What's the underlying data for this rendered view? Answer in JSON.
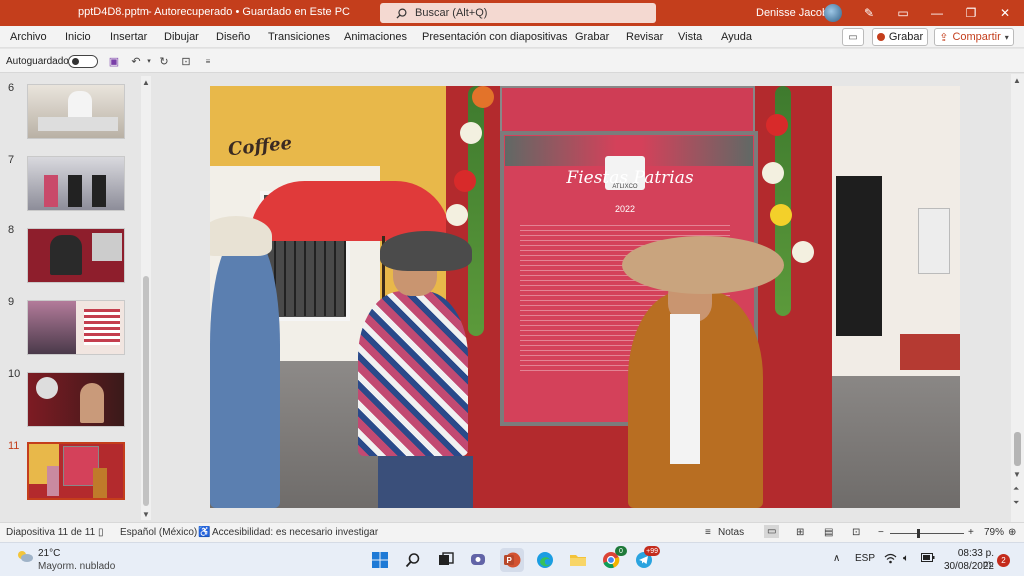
{
  "titlebar": {
    "doc_name": "pptD4D8.pptm",
    "status": "-  Autorecuperado • Guardado en Este PC",
    "search_placeholder": "Buscar (Alt+Q)",
    "user_name": "Denisse Jacobo"
  },
  "menu": [
    "Archivo",
    "Inicio",
    "Insertar",
    "Dibujar",
    "Diseño",
    "Transiciones",
    "Animaciones",
    "Presentación con diapositivas",
    "Grabar",
    "Revisar",
    "Vista",
    "Ayuda"
  ],
  "actions": {
    "grabar": "Grabar",
    "compartir": "Compartir"
  },
  "qat": {
    "autosave_label": "Autoguardado"
  },
  "thumbnails": [
    {
      "num": "6"
    },
    {
      "num": "7"
    },
    {
      "num": "8"
    },
    {
      "num": "9"
    },
    {
      "num": "10"
    },
    {
      "num": "11",
      "active": true
    }
  ],
  "slide": {
    "sign": "Coffee",
    "board_title": "Fiestas  Patrias",
    "board_year": "2022",
    "board_logo": "ATLIXCO"
  },
  "statusbar": {
    "slide_counter": "Diapositiva 11 de 11",
    "language": "Español (México)",
    "accessibility": "Accesibilidad: es necesario investigar",
    "notes": "Notas",
    "zoom": "79%"
  },
  "taskbar": {
    "weather_temp": "21°C",
    "weather_desc": "Mayorm. nublado",
    "lang": "ESP",
    "time": "08:33 p. m.",
    "date": "30/08/2022",
    "notifications": "2",
    "chrome_badge": "0",
    "telegram_badge": "+99"
  },
  "colors": {
    "brand": "#c43e1c",
    "board": "#d4415a"
  }
}
